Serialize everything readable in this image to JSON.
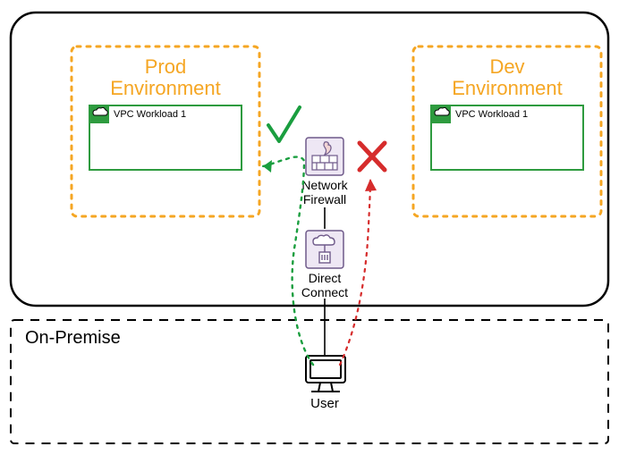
{
  "cloud": {
    "prod": {
      "title_line1": "Prod",
      "title_line2": "Environment",
      "vpc_label": "VPC Workload 1"
    },
    "dev": {
      "title_line1": "Dev",
      "title_line2": "Environment",
      "vpc_label": "VPC Workload 1"
    },
    "firewall_label_line1": "Network",
    "firewall_label_line2": "Firewall",
    "direct_connect_label_line1": "Direct",
    "direct_connect_label_line2": "Connect"
  },
  "on_premise": {
    "title": "On-Premise",
    "user_label": "User"
  },
  "marks": {
    "allow": "✓",
    "deny": "✕"
  },
  "colors": {
    "env_border": "#f5a623",
    "vpc_border": "#2e9b3f",
    "allow": "#1a9e3f",
    "deny": "#d62c2c",
    "black": "#000000",
    "icon_bg": "#e8e4f2",
    "icon_border": "#6f5a8a"
  }
}
